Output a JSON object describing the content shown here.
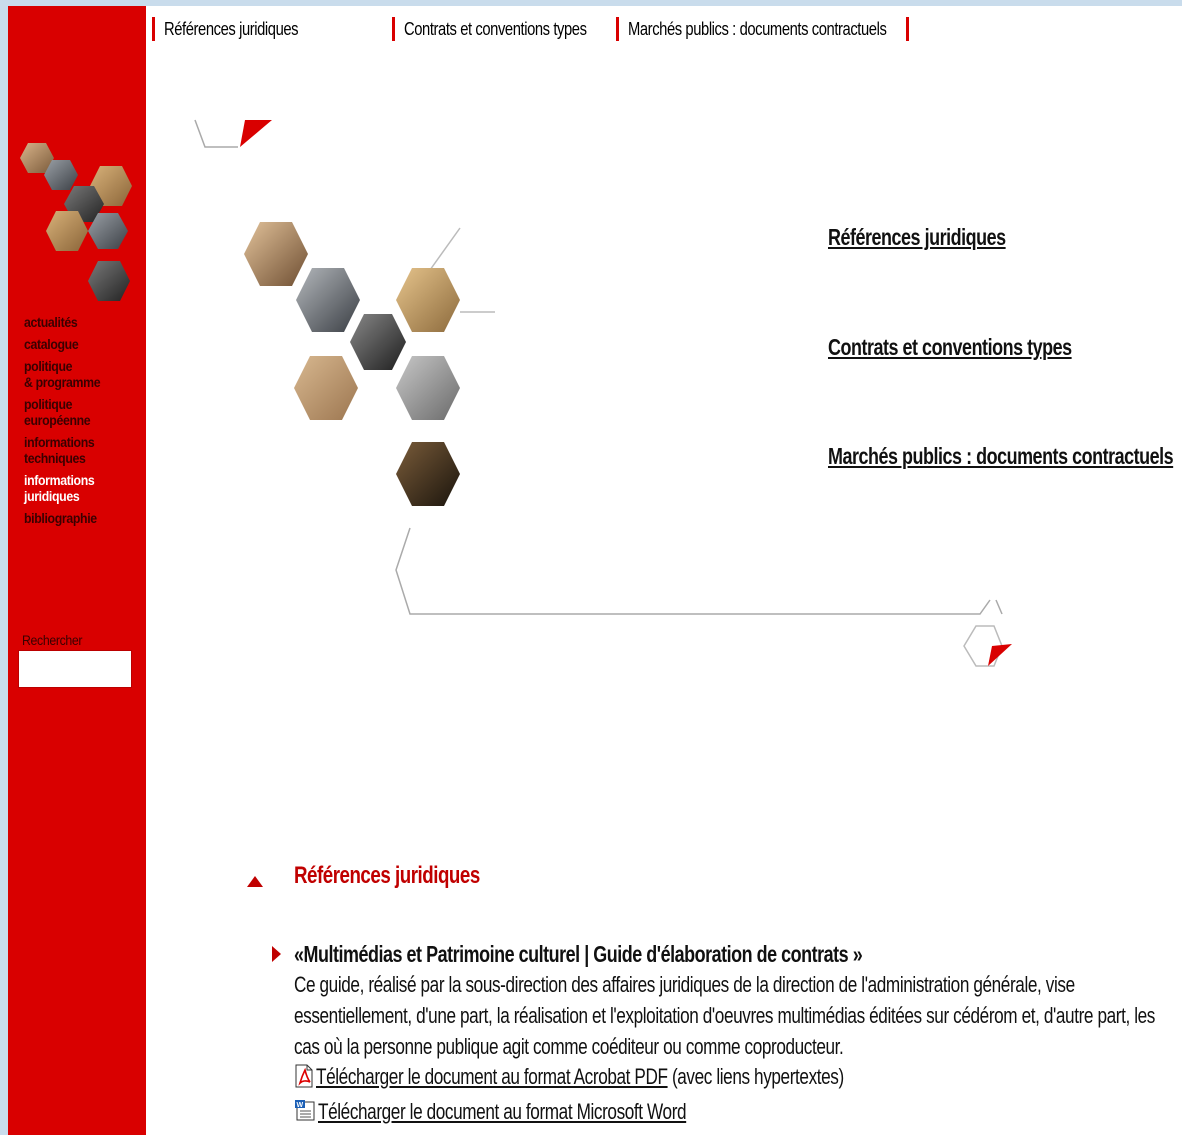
{
  "topnav": {
    "links": [
      "Références juridiques",
      "Contrats et conventions types",
      "Marchés publics : documents contractuels"
    ]
  },
  "sidebar": {
    "items": [
      {
        "label": "actualités"
      },
      {
        "label": "catalogue"
      },
      {
        "label": "politique"
      },
      {
        "label": "& programme"
      },
      {
        "label": "politique"
      },
      {
        "label": "européenne"
      },
      {
        "label": "informations"
      },
      {
        "label": "techniques"
      },
      {
        "label": "informations"
      },
      {
        "label": "juridiques"
      },
      {
        "label": "bibliographie"
      }
    ],
    "search_label": "Rechercher",
    "search_value": ""
  },
  "main": {
    "links": [
      "Références juridiques",
      "Contrats et conventions types",
      "Marchés publics : documents contractuels"
    ],
    "section_title": "Références juridiques",
    "item": {
      "title": "«Multimédias et Patrimoine culturel | Guide d'élaboration de contrats »",
      "description_lines": [
        "Ce guide, réalisé par la sous-direction des affaires juridiques de la direction de l'administration générale, vise",
        "essentiellement, d'une part, la réalisation et l'exploitation d'oeuvres multimédias éditées sur cédérom et, d'autre part, les",
        "cas où la personne publique agit comme coéditeur ou comme coproducteur."
      ],
      "download_pdf_link": "Télécharger le document au format Acrobat PDF",
      "download_pdf_note": " (avec liens hypertextes)",
      "download_word_link": "Télécharger le document au format Microsoft Word"
    }
  },
  "colors": {
    "brand_red": "#d90000",
    "frame_blue": "#c9dcec"
  },
  "icons": [
    "pdf-icon",
    "word-icon",
    "triangle-up-icon",
    "triangle-right-icon"
  ]
}
